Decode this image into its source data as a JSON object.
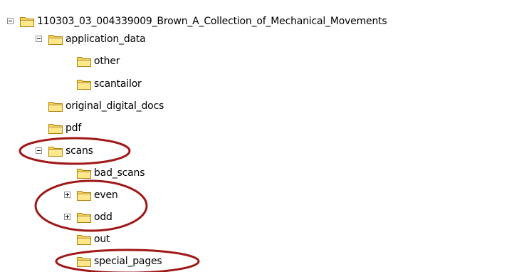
{
  "tree": {
    "root": {
      "label": "110303_03_004339009_Brown_A_Collection_of_Mechanical_Movements",
      "state": "expanded"
    },
    "application_data": {
      "label": "application_data",
      "state": "expanded"
    },
    "other": {
      "label": "other"
    },
    "scantailor": {
      "label": "scantailor"
    },
    "original_digital_docs": {
      "label": "original_digital_docs"
    },
    "pdf": {
      "label": "pdf"
    },
    "scans": {
      "label": "scans",
      "state": "expanded"
    },
    "bad_scans": {
      "label": "bad_scans"
    },
    "even": {
      "label": "even",
      "state": "collapsed"
    },
    "odd": {
      "label": "odd",
      "state": "collapsed"
    },
    "out": {
      "label": "out"
    },
    "special_pages": {
      "label": "special_pages"
    }
  },
  "icons": {
    "folder": "folder-icon",
    "expander": "expand-collapse-icon"
  },
  "colors": {
    "folder_body": "#f6d25a",
    "folder_front": "#ffe88a",
    "folder_outline": "#b08410",
    "highlight_ellipse": "#a01818"
  }
}
